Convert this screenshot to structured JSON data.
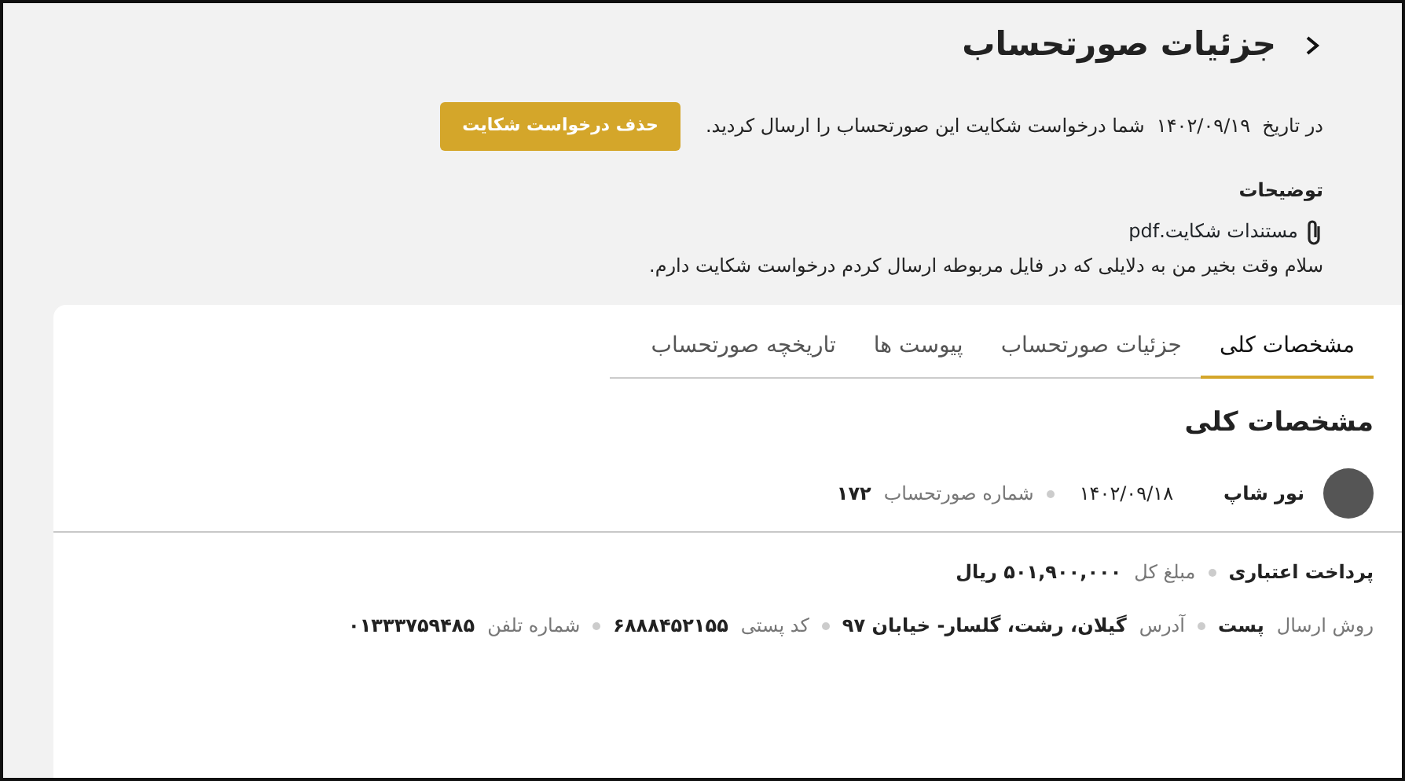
{
  "header": {
    "title": "جزئیات صورتحساب"
  },
  "notice": {
    "text": "در تاریخ  ۱۴۰۲/۰۹/۱۹  شما درخواست شکایت این صورتحساب را ارسال کردید.",
    "button": "حذف درخواست شکایت"
  },
  "description": {
    "heading": "توضیحات",
    "attachment": "مستندات شکایت.pdf",
    "message": "سلام وقت بخیر من به دلایلی که در فایل مربوطه ارسال کردم درخواست شکایت دارم."
  },
  "tabs": [
    {
      "label": "مشخصات کلی",
      "selected": true
    },
    {
      "label": "جزئیات صورتحساب",
      "selected": false
    },
    {
      "label": "پیوست ها",
      "selected": false
    },
    {
      "label": "تاریخچه صورتحساب",
      "selected": false
    }
  ],
  "overview": {
    "title": "مشخصات کلی",
    "seller": "نور شاپ",
    "date": "۱۴۰۲/۰۹/۱۸",
    "invoice_label": "شماره صورتحساب",
    "invoice_number": "۱۷۲",
    "rows": [
      [
        {
          "value": "پرداخت اعتباری"
        },
        {
          "label": "مبلغ کل",
          "value": "۵۰۱,۹۰۰,۰۰۰ ریال"
        }
      ],
      [
        {
          "label": "روش ارسال",
          "value": "پست"
        },
        {
          "label": "آدرس",
          "value": "گیلان، رشت، گلسار- خیابان ۹۷"
        },
        {
          "label": "کد پستی",
          "value": "۶۸۸۸۴۵۲۱۵۵"
        },
        {
          "label": "شماره تلفن",
          "value": "۰۱۳۳۳۷۵۹۴۸۵"
        }
      ]
    ]
  }
}
